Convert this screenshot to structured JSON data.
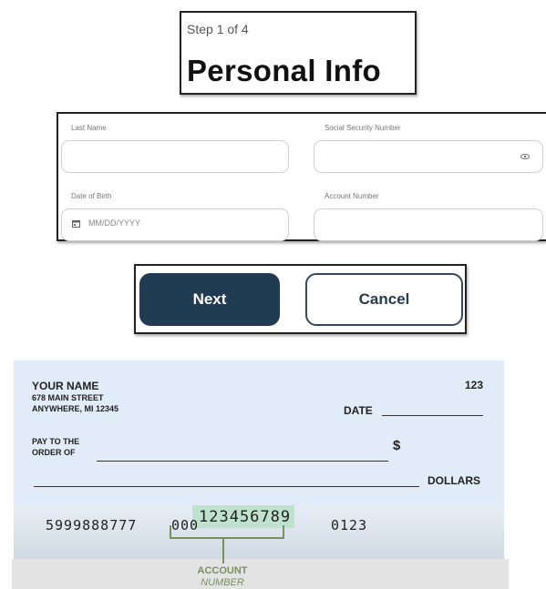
{
  "step": {
    "progress": "Step 1 of 4",
    "title": "Personal Info"
  },
  "form": {
    "last_name": {
      "label": "Last Name",
      "value": ""
    },
    "ssn": {
      "label": "Social Security Number",
      "value": "",
      "icon": "eye-icon"
    },
    "dob": {
      "label": "Date of Birth",
      "placeholder": "MM/DD/YYYY",
      "icon": "calendar-icon"
    },
    "account_number": {
      "label": "Account Number",
      "value": ""
    }
  },
  "buttons": {
    "next": "Next",
    "cancel": "Cancel"
  },
  "check": {
    "name": "YOUR NAME",
    "address1": "678 MAIN STREET",
    "address2": "ANYWHERE, MI  12345",
    "check_number": "123",
    "date_label": "DATE",
    "pay_to_line1": "PAY TO THE",
    "pay_to_line2": "ORDER OF",
    "dollar_sign": "$",
    "dollars_label": "DOLLARS",
    "routing": "5999888777",
    "account_prefix": "000",
    "account": "123456789",
    "check_micr": "0123",
    "callout_line1": "ACCOUNT",
    "callout_line2": "NUMBER"
  },
  "colors": {
    "primary": "#213b53",
    "check_bg": "#e2ecf8",
    "highlight": "#bfe2cc",
    "callout": "#78925e"
  }
}
